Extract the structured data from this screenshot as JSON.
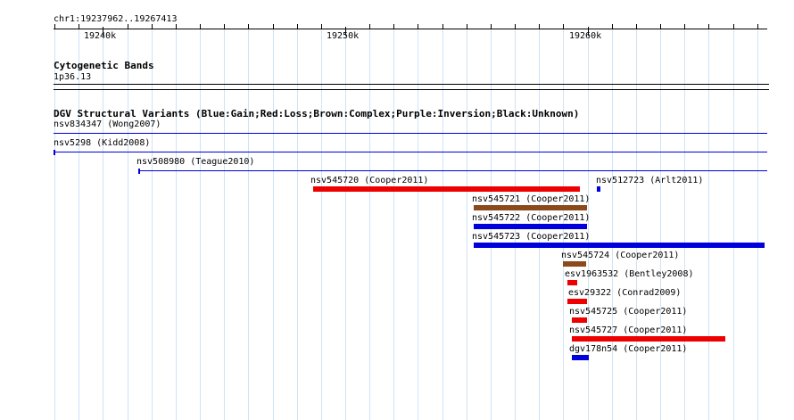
{
  "position": {
    "label": "chr1:19237962..19267413",
    "start": 19237962,
    "end": 19267413
  },
  "ruler": {
    "major_ticks": [
      {
        "pos": 19240000,
        "label": "19240k"
      },
      {
        "pos": 19250000,
        "label": "19250k"
      },
      {
        "pos": 19260000,
        "label": "19260k"
      }
    ]
  },
  "cytoband": {
    "title": "Cytogenetic Bands",
    "band": "1p36.13"
  },
  "dgv": {
    "title": "DGV Structural Variants (Blue:Gain;Red:Loss;Brown:Complex;Purple:Inversion;Black:Unknown)",
    "colors": {
      "gain": "#0000dd",
      "loss": "#ee0000",
      "complex": "#8b4a1c",
      "unknown": "#000000"
    },
    "features": [
      {
        "label": "nsv834347 (Wong2007)",
        "type": "gain",
        "start": 19237962,
        "end": 19267413,
        "style": "line"
      },
      {
        "label": "nsv5298 (Kidd2008)",
        "type": "gain",
        "start": 19237962,
        "end": 19267413,
        "style": "line_left_cap"
      },
      {
        "label": "nsv508980 (Teague2010)",
        "type": "gain",
        "start": 19241450,
        "end": 19267413,
        "style": "line_left_cap"
      },
      {
        "label": "nsv545720 (Cooper2011)",
        "type": "loss",
        "start": 19248670,
        "end": 19259680,
        "style": "bar"
      },
      {
        "label": "nsv512723 (Arlt2011)",
        "type": "gain",
        "start": 19260380,
        "end": 19260510,
        "style": "bar"
      },
      {
        "label": "nsv545721 (Cooper2011)",
        "type": "complex",
        "start": 19255290,
        "end": 19259970,
        "style": "bar"
      },
      {
        "label": "nsv545722 (Cooper2011)",
        "type": "gain",
        "start": 19255290,
        "end": 19259970,
        "style": "bar"
      },
      {
        "label": "nsv545723 (Cooper2011)",
        "type": "gain",
        "start": 19255290,
        "end": 19267300,
        "style": "bar"
      },
      {
        "label": "nsv545724 (Cooper2011)",
        "type": "complex",
        "start": 19259000,
        "end": 19259960,
        "style": "bar"
      },
      {
        "label": "esv1963532 (Bentley2008)",
        "type": "loss",
        "start": 19259150,
        "end": 19259550,
        "style": "bar"
      },
      {
        "label": "esv29322 (Conrad2009)",
        "type": "loss",
        "start": 19259180,
        "end": 19259990,
        "style": "bar"
      },
      {
        "label": "nsv545725 (Cooper2011)",
        "type": "loss",
        "start": 19259360,
        "end": 19259990,
        "style": "bar"
      },
      {
        "label": "nsv545727 (Cooper2011)",
        "type": "loss",
        "start": 19259360,
        "end": 19265700,
        "style": "bar"
      },
      {
        "label": "dgv178n54 (Cooper2011)",
        "type": "gain",
        "start": 19259360,
        "end": 19260070,
        "style": "bar"
      }
    ]
  }
}
